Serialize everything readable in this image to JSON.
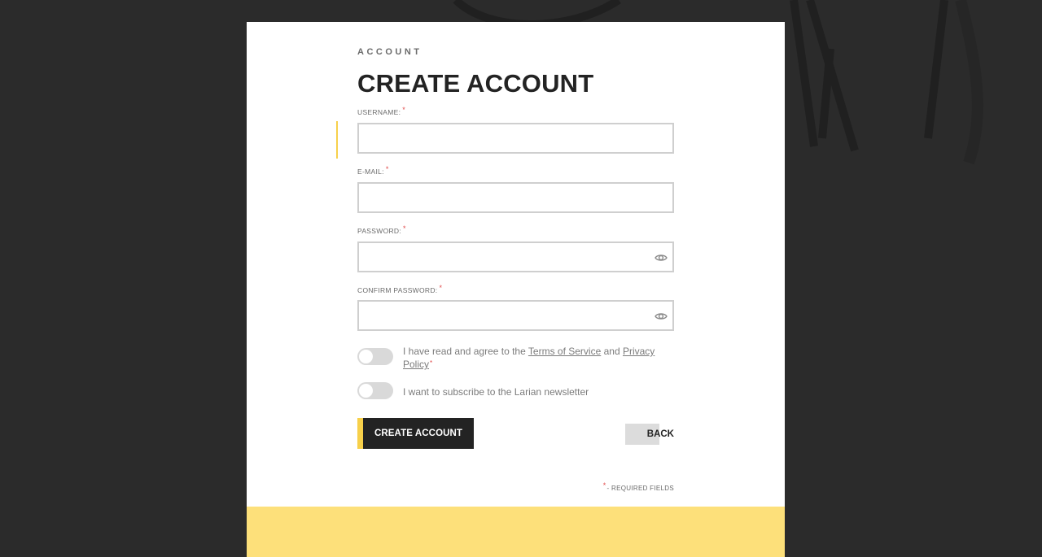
{
  "page": {
    "eyebrow": "ACCOUNT",
    "title": "CREATE ACCOUNT"
  },
  "form": {
    "required_marker": "*",
    "username": {
      "label": "USERNAME:",
      "value": "",
      "placeholder": ""
    },
    "email": {
      "label": "E-MAIL:",
      "value": "",
      "placeholder": ""
    },
    "password": {
      "label": "PASSWORD:",
      "value": "",
      "placeholder": ""
    },
    "confirm_password": {
      "label": "CONFIRM PASSWORD:",
      "value": "",
      "placeholder": ""
    },
    "terms": {
      "prefix": "I have read and agree to the ",
      "terms_link": "Terms of Service",
      "middle": " and ",
      "privacy_link": "Privacy Policy",
      "enabled": false
    },
    "newsletter": {
      "text": "I want to subscribe to the Larian newsletter",
      "enabled": false
    },
    "create_button": "CREATE ACCOUNT",
    "back_button": "BACK",
    "required_note": "- REQUIRED FIELDS"
  },
  "icons": {
    "password_toggle": "eye-icon",
    "confirm_password_toggle": "eye-icon"
  },
  "colors": {
    "background": "#2b2b2b",
    "card": "#ffffff",
    "accent": "#f7d04a",
    "footer": "#fde07a",
    "button_dark": "#232323",
    "required": "#e14b4b"
  }
}
